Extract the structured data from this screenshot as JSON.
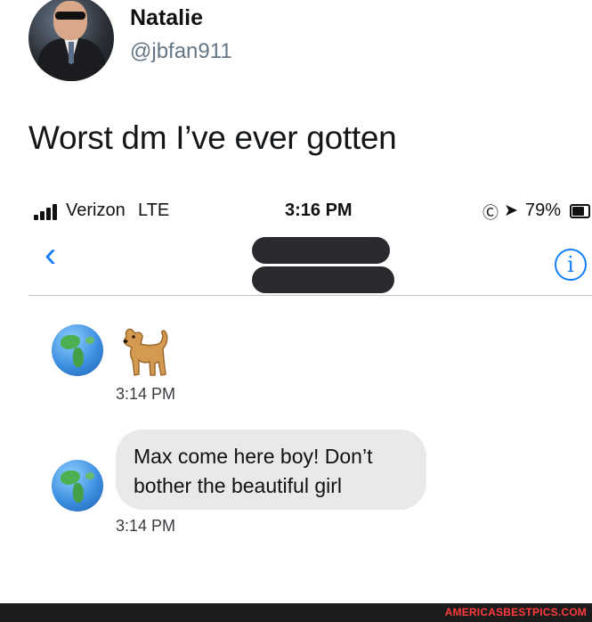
{
  "tweet": {
    "name": "Natalie",
    "handle": "@jbfan911",
    "text": "Worst dm I’ve ever gotten"
  },
  "status_bar": {
    "carrier": "Verizon",
    "network": "LTE",
    "time": "3:16 PM",
    "battery": "79%",
    "battery_level": 0.79
  },
  "nav": {
    "back_icon": "chevron-left",
    "info_icon": "info-circle",
    "accent_color": "#147efb"
  },
  "messages": [
    {
      "sender_icon": "globe-emoji",
      "content_icon": "dog-emoji",
      "timestamp": "3:14 PM"
    },
    {
      "sender_icon": "globe-emoji",
      "text": "Max come here boy! Don’t bother the beautiful girl",
      "timestamp": "3:14 PM"
    }
  ],
  "footer": {
    "watermark": "AMERICASBESTPICS.COM",
    "watermark_color": "#ff3b3b"
  }
}
